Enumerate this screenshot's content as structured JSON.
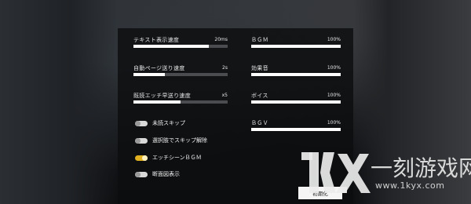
{
  "left_settings": [
    {
      "label": "テキスト表示速度",
      "value": "20ms",
      "level": 0.8
    },
    {
      "label": "自動ページ送り速度",
      "value": "2s",
      "level": 0.33
    },
    {
      "label": "既読エッチ早送り速度",
      "value": "x5",
      "level": 0.5
    }
  ],
  "right_settings": [
    {
      "label": "ＢＧＭ",
      "value": "100%",
      "level": 1.0
    },
    {
      "label": "効果音",
      "value": "100%",
      "level": 1.0
    },
    {
      "label": "ボイス",
      "value": "100%",
      "level": 1.0
    },
    {
      "label": "ＢＧＶ",
      "value": "100%",
      "level": 1.0
    }
  ],
  "toggles": [
    {
      "label": "未読スキップ",
      "on": false
    },
    {
      "label": "選択肢でスキップ解除",
      "on": false
    },
    {
      "label": "エッチシーンＢＧＭ",
      "on": true
    },
    {
      "label": "断面図表示",
      "on": false
    }
  ],
  "reset_button": "初期化",
  "watermark": {
    "logo": "1kyx",
    "name": "一刻游戏网",
    "url": "www.1kyx.com"
  },
  "colors": {
    "accent_toggle_on": "#e0b020",
    "bar_fill": "#ffffff",
    "bar_track": "#4a4c50",
    "panel_bg": "#0c0d0f"
  }
}
